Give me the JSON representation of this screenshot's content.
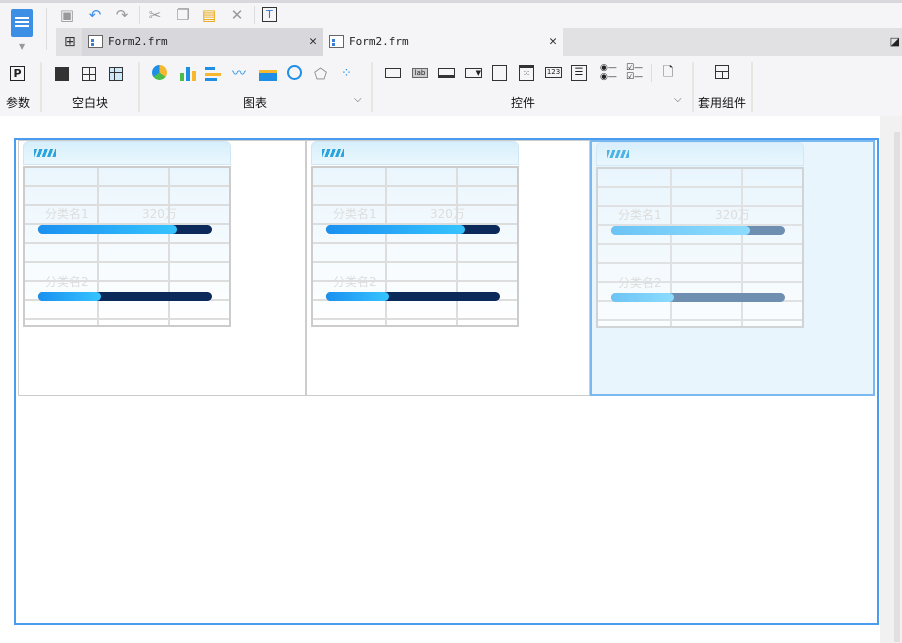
{
  "tabs": [
    {
      "label": "Form2.frm",
      "active": false
    },
    {
      "label": "Form2.frm",
      "active": true
    }
  ],
  "ribbon": {
    "groups": [
      {
        "label": "参数"
      },
      {
        "label": "空白块"
      },
      {
        "label": "图表"
      },
      {
        "label": "控件"
      },
      {
        "label": "套用组件"
      }
    ]
  },
  "toolbar": {
    "icons": [
      "save-icon",
      "undo-icon",
      "redo-icon",
      "cut-icon",
      "copy-icon",
      "paste-icon",
      "delete-icon",
      "text-search-icon"
    ]
  },
  "widgets": [
    {
      "row1_label": "分类名1",
      "row1_value": "320万",
      "row1_progress": 0.8,
      "row2_label": "分类名2",
      "row2_progress": 0.36,
      "selected": false
    },
    {
      "row1_label": "分类名1",
      "row1_value": "320万",
      "row1_progress": 0.8,
      "row2_label": "分类名2",
      "row2_progress": 0.36,
      "selected": false
    },
    {
      "row1_label": "分类名1",
      "row1_value": "320万",
      "row1_progress": 0.8,
      "row2_label": "分类名2",
      "row2_progress": 0.36,
      "selected": true
    }
  ],
  "colors": {
    "accent": "#4a9cf0",
    "bar_track": "#0b2a5a",
    "bar_fill": "#36c4ff"
  }
}
